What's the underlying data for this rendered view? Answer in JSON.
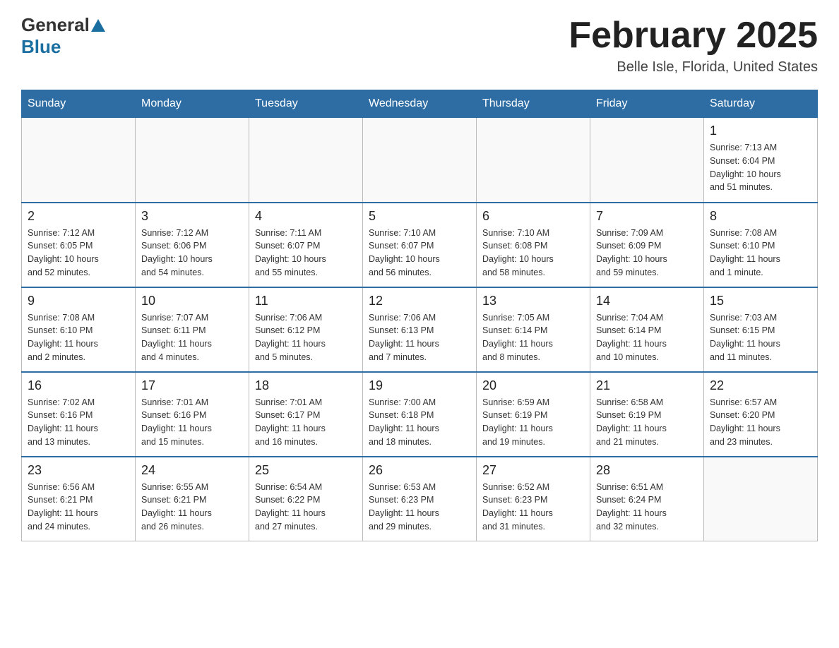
{
  "header": {
    "logo_general": "General",
    "logo_blue": "Blue",
    "title": "February 2025",
    "subtitle": "Belle Isle, Florida, United States"
  },
  "weekdays": [
    "Sunday",
    "Monday",
    "Tuesday",
    "Wednesday",
    "Thursday",
    "Friday",
    "Saturday"
  ],
  "weeks": [
    [
      {
        "day": "",
        "info": ""
      },
      {
        "day": "",
        "info": ""
      },
      {
        "day": "",
        "info": ""
      },
      {
        "day": "",
        "info": ""
      },
      {
        "day": "",
        "info": ""
      },
      {
        "day": "",
        "info": ""
      },
      {
        "day": "1",
        "info": "Sunrise: 7:13 AM\nSunset: 6:04 PM\nDaylight: 10 hours\nand 51 minutes."
      }
    ],
    [
      {
        "day": "2",
        "info": "Sunrise: 7:12 AM\nSunset: 6:05 PM\nDaylight: 10 hours\nand 52 minutes."
      },
      {
        "day": "3",
        "info": "Sunrise: 7:12 AM\nSunset: 6:06 PM\nDaylight: 10 hours\nand 54 minutes."
      },
      {
        "day": "4",
        "info": "Sunrise: 7:11 AM\nSunset: 6:07 PM\nDaylight: 10 hours\nand 55 minutes."
      },
      {
        "day": "5",
        "info": "Sunrise: 7:10 AM\nSunset: 6:07 PM\nDaylight: 10 hours\nand 56 minutes."
      },
      {
        "day": "6",
        "info": "Sunrise: 7:10 AM\nSunset: 6:08 PM\nDaylight: 10 hours\nand 58 minutes."
      },
      {
        "day": "7",
        "info": "Sunrise: 7:09 AM\nSunset: 6:09 PM\nDaylight: 10 hours\nand 59 minutes."
      },
      {
        "day": "8",
        "info": "Sunrise: 7:08 AM\nSunset: 6:10 PM\nDaylight: 11 hours\nand 1 minute."
      }
    ],
    [
      {
        "day": "9",
        "info": "Sunrise: 7:08 AM\nSunset: 6:10 PM\nDaylight: 11 hours\nand 2 minutes."
      },
      {
        "day": "10",
        "info": "Sunrise: 7:07 AM\nSunset: 6:11 PM\nDaylight: 11 hours\nand 4 minutes."
      },
      {
        "day": "11",
        "info": "Sunrise: 7:06 AM\nSunset: 6:12 PM\nDaylight: 11 hours\nand 5 minutes."
      },
      {
        "day": "12",
        "info": "Sunrise: 7:06 AM\nSunset: 6:13 PM\nDaylight: 11 hours\nand 7 minutes."
      },
      {
        "day": "13",
        "info": "Sunrise: 7:05 AM\nSunset: 6:14 PM\nDaylight: 11 hours\nand 8 minutes."
      },
      {
        "day": "14",
        "info": "Sunrise: 7:04 AM\nSunset: 6:14 PM\nDaylight: 11 hours\nand 10 minutes."
      },
      {
        "day": "15",
        "info": "Sunrise: 7:03 AM\nSunset: 6:15 PM\nDaylight: 11 hours\nand 11 minutes."
      }
    ],
    [
      {
        "day": "16",
        "info": "Sunrise: 7:02 AM\nSunset: 6:16 PM\nDaylight: 11 hours\nand 13 minutes."
      },
      {
        "day": "17",
        "info": "Sunrise: 7:01 AM\nSunset: 6:16 PM\nDaylight: 11 hours\nand 15 minutes."
      },
      {
        "day": "18",
        "info": "Sunrise: 7:01 AM\nSunset: 6:17 PM\nDaylight: 11 hours\nand 16 minutes."
      },
      {
        "day": "19",
        "info": "Sunrise: 7:00 AM\nSunset: 6:18 PM\nDaylight: 11 hours\nand 18 minutes."
      },
      {
        "day": "20",
        "info": "Sunrise: 6:59 AM\nSunset: 6:19 PM\nDaylight: 11 hours\nand 19 minutes."
      },
      {
        "day": "21",
        "info": "Sunrise: 6:58 AM\nSunset: 6:19 PM\nDaylight: 11 hours\nand 21 minutes."
      },
      {
        "day": "22",
        "info": "Sunrise: 6:57 AM\nSunset: 6:20 PM\nDaylight: 11 hours\nand 23 minutes."
      }
    ],
    [
      {
        "day": "23",
        "info": "Sunrise: 6:56 AM\nSunset: 6:21 PM\nDaylight: 11 hours\nand 24 minutes."
      },
      {
        "day": "24",
        "info": "Sunrise: 6:55 AM\nSunset: 6:21 PM\nDaylight: 11 hours\nand 26 minutes."
      },
      {
        "day": "25",
        "info": "Sunrise: 6:54 AM\nSunset: 6:22 PM\nDaylight: 11 hours\nand 27 minutes."
      },
      {
        "day": "26",
        "info": "Sunrise: 6:53 AM\nSunset: 6:23 PM\nDaylight: 11 hours\nand 29 minutes."
      },
      {
        "day": "27",
        "info": "Sunrise: 6:52 AM\nSunset: 6:23 PM\nDaylight: 11 hours\nand 31 minutes."
      },
      {
        "day": "28",
        "info": "Sunrise: 6:51 AM\nSunset: 6:24 PM\nDaylight: 11 hours\nand 32 minutes."
      },
      {
        "day": "",
        "info": ""
      }
    ]
  ]
}
